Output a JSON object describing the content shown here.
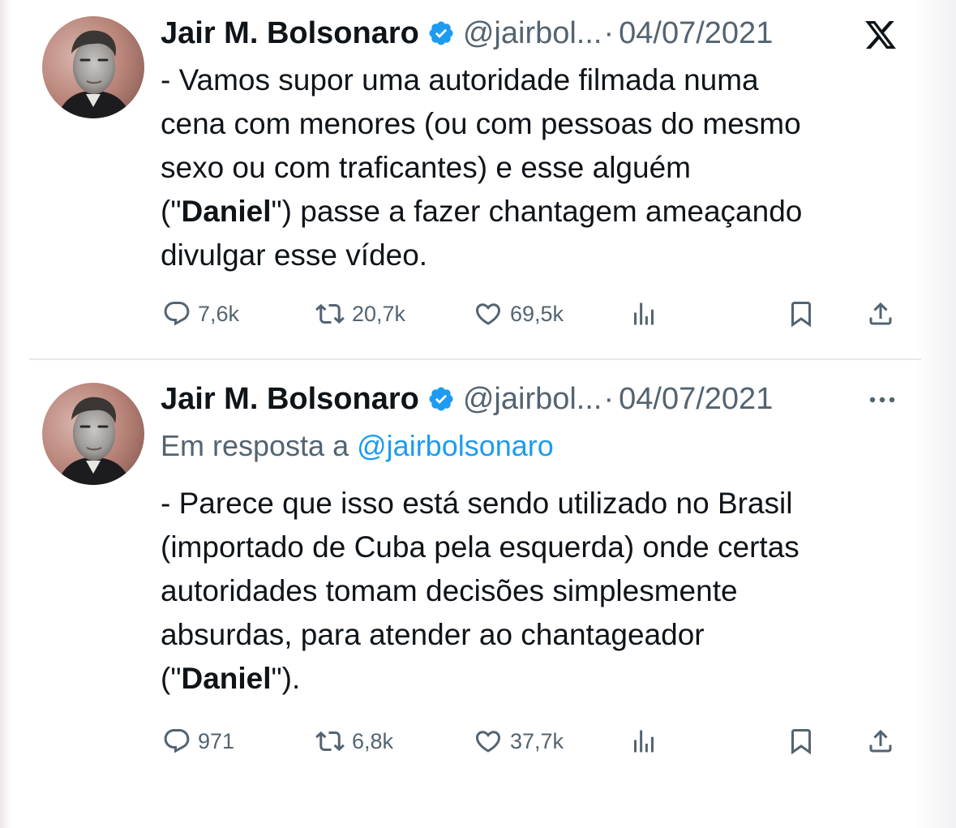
{
  "colors": {
    "verified": "#1d9bf0",
    "link": "#1d9bf0",
    "text": "#0f1419",
    "secondary": "#536471",
    "divider": "#e7e9ea"
  },
  "tweets": [
    {
      "author": {
        "name": "Jair M. Bolsonaro",
        "verified_icon": "verified-badge-icon",
        "handle": "@jairbol...",
        "separator": "·",
        "date": "04/07/2021",
        "avatar": "profile-photo"
      },
      "top_right_icon": "x-logo-icon",
      "body_lines": [
        {
          "before": "- Vamos supor uma autoridade filmada numa",
          "bold": "",
          "after": ""
        },
        {
          "before": "cena com menores (ou com pessoas do mesmo",
          "bold": "",
          "after": ""
        },
        {
          "before": "sexo ou com traficantes) e esse alguém",
          "bold": "",
          "after": ""
        },
        {
          "before": "(\"",
          "bold": "Daniel",
          "after": "\") passe a fazer chantagem ameaçando"
        },
        {
          "before": "divulgar esse vídeo.",
          "bold": "",
          "after": ""
        }
      ],
      "stats": {
        "replies": "7,6k",
        "retweets": "20,7k",
        "likes": "69,5k"
      }
    },
    {
      "author": {
        "name": "Jair M. Bolsonaro",
        "verified_icon": "verified-badge-icon",
        "handle": "@jairbol...",
        "separator": "·",
        "date": "04/07/2021",
        "avatar": "profile-photo"
      },
      "top_right_icon": "more-options-icon",
      "reply_to": {
        "prefix": "Em resposta a",
        "mention": "@jairbolsonaro"
      },
      "body_lines": [
        {
          "before": "- Parece que isso está sendo utilizado no Brasil",
          "bold": "",
          "after": ""
        },
        {
          "before": "(importado de Cuba pela esquerda) onde certas",
          "bold": "",
          "after": ""
        },
        {
          "before": "autoridades tomam decisões simplesmente",
          "bold": "",
          "after": ""
        },
        {
          "before": "absurdas, para atender ao chantageador",
          "bold": "",
          "after": ""
        },
        {
          "before": "(\"",
          "bold": "Daniel",
          "after": "\")."
        }
      ],
      "stats": {
        "replies": "971",
        "retweets": "6,8k",
        "likes": "37,7k"
      }
    }
  ]
}
